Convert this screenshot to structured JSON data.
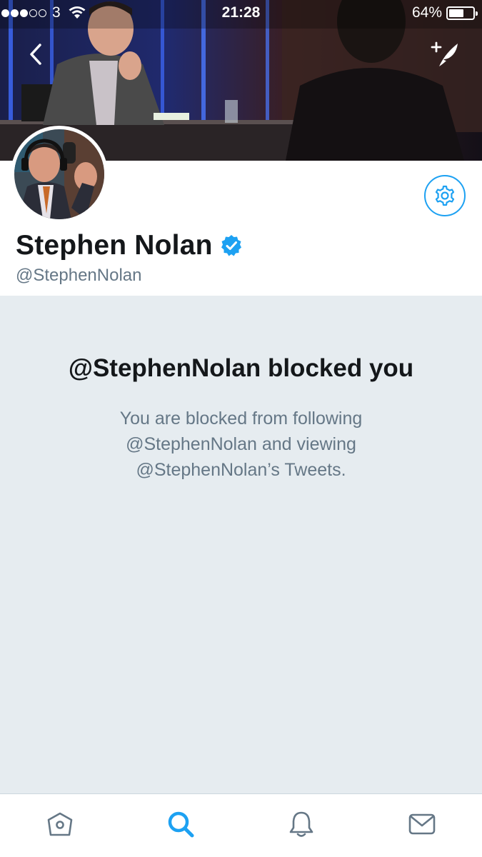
{
  "status_bar": {
    "carrier": "3",
    "time": "21:28",
    "battery": "64%",
    "battery_level": 0.64,
    "signal_bars_filled": 3,
    "signal_bars_total": 5
  },
  "header": {
    "back_icon": "chevron-left-icon",
    "compose_icon": "compose-tweet-icon"
  },
  "profile": {
    "name": "Stephen Nolan",
    "handle": "@StephenNolan",
    "verified": true,
    "verified_color": "#1da1f2",
    "settings_icon": "gear-icon"
  },
  "blocked": {
    "title": "@StephenNolan blocked you",
    "message": "You are blocked from following @StephenNolan and viewing @StephenNolan’s Tweets."
  },
  "tab_bar": {
    "tabs": [
      {
        "icon": "home-icon",
        "active": false
      },
      {
        "icon": "search-icon",
        "active": true
      },
      {
        "icon": "notifications-icon",
        "active": false
      },
      {
        "icon": "messages-icon",
        "active": false
      }
    ],
    "active_color": "#1da1f2",
    "inactive_color": "#657786"
  },
  "colors": {
    "accent": "#1da1f2",
    "panel_background": "#e6ecf0",
    "secondary_text": "#657786"
  }
}
